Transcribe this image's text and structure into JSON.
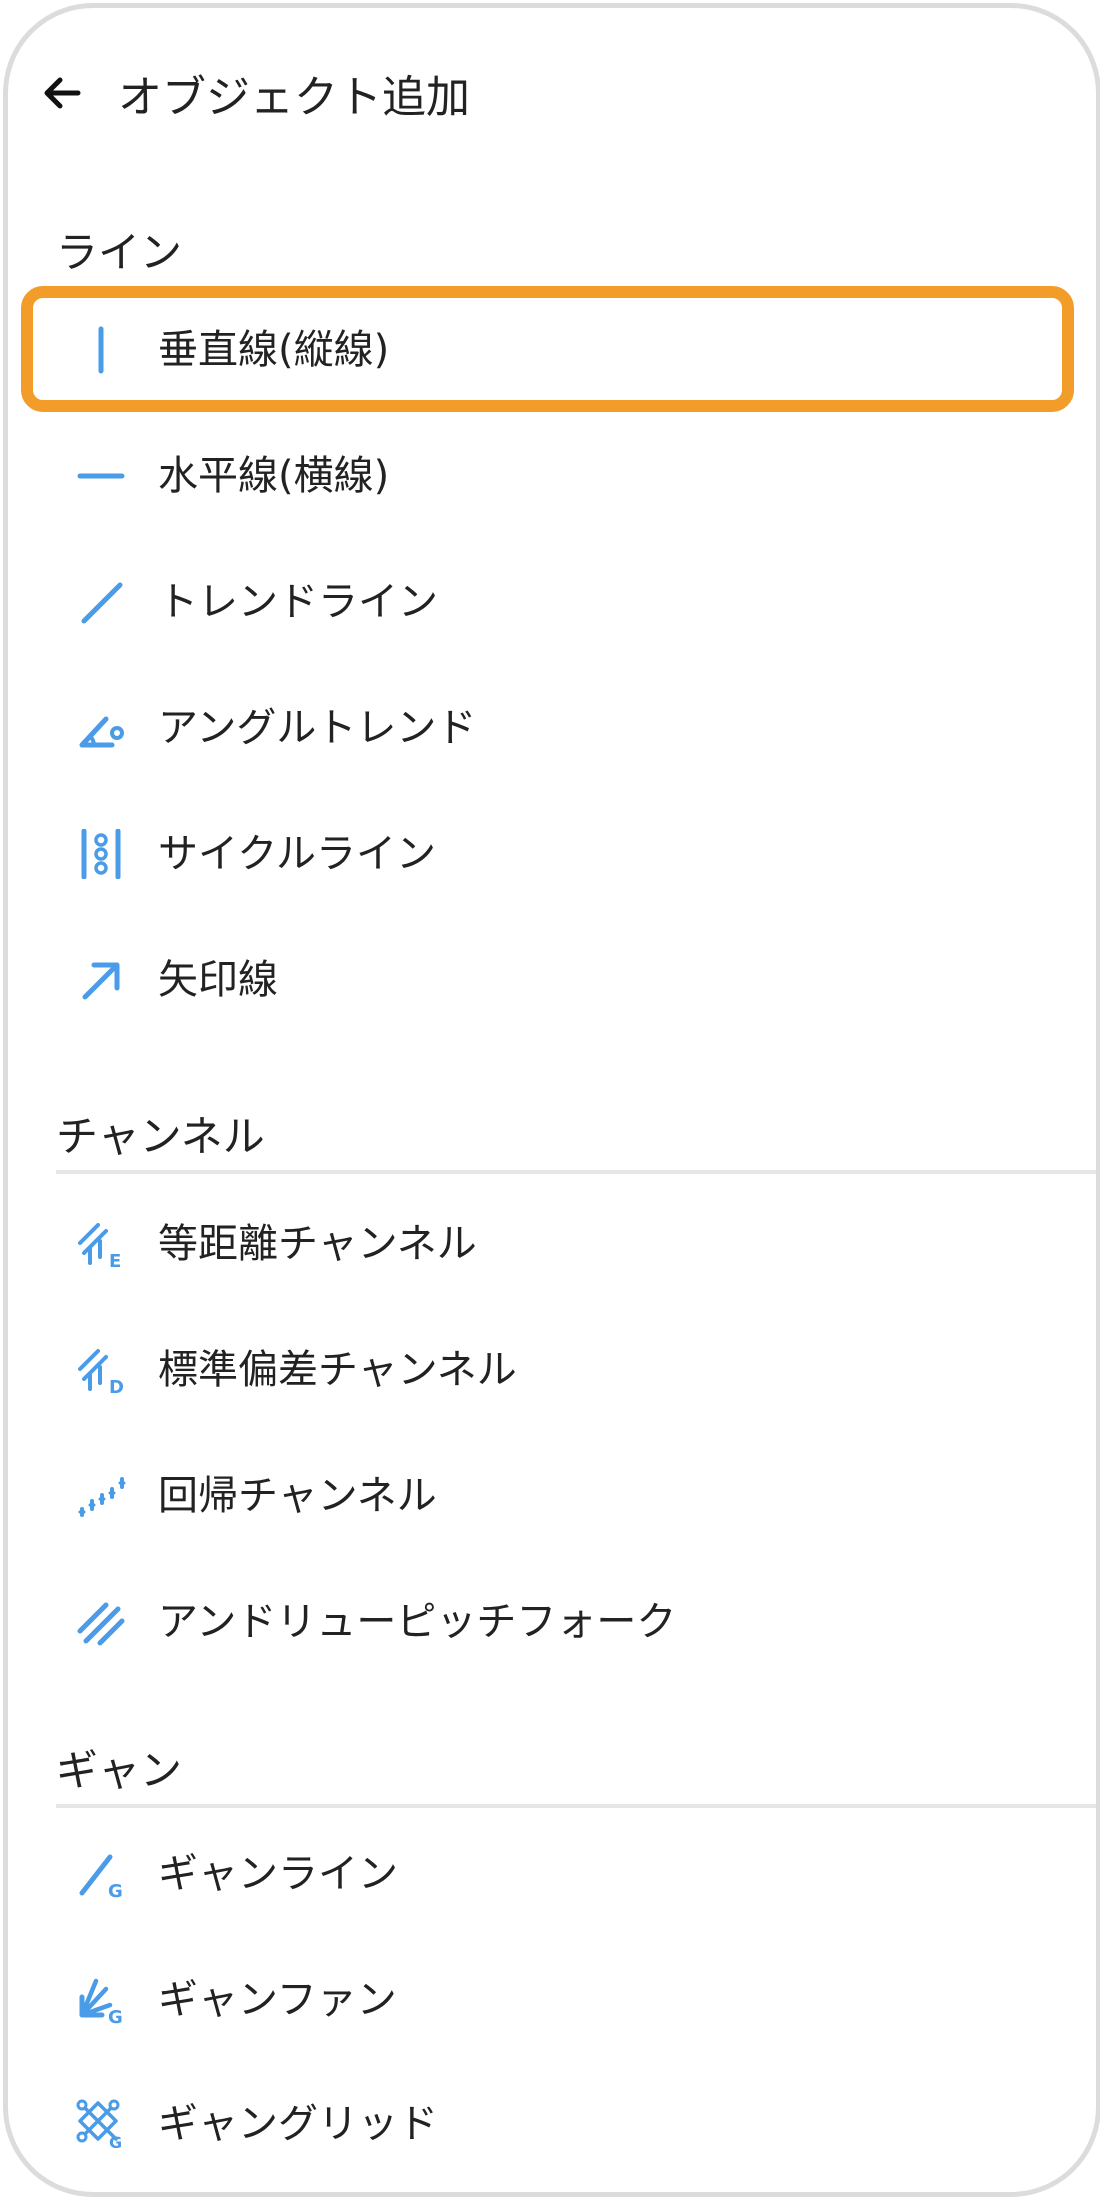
{
  "header": {
    "title": "オブジェクト追加",
    "back_icon": "arrow-left-icon"
  },
  "accent_color": "#4a9be8",
  "highlight_color": "#f29d2a",
  "sections": [
    {
      "title": "ライン",
      "items": [
        {
          "label": "垂直線(縦線)",
          "icon": "vertical-line-icon"
        },
        {
          "label": "水平線(横線)",
          "icon": "horizontal-line-icon"
        },
        {
          "label": "トレンドライン",
          "icon": "trend-line-icon"
        },
        {
          "label": "アングルトレンド",
          "icon": "angle-trend-icon"
        },
        {
          "label": "サイクルライン",
          "icon": "cycle-line-icon"
        },
        {
          "label": "矢印線",
          "icon": "arrow-line-icon"
        }
      ]
    },
    {
      "title": "チャンネル",
      "items": [
        {
          "label": "等距離チャンネル",
          "icon": "equidistant-channel-icon"
        },
        {
          "label": "標準偏差チャンネル",
          "icon": "std-deviation-channel-icon"
        },
        {
          "label": "回帰チャンネル",
          "icon": "regression-channel-icon"
        },
        {
          "label": "アンドリューピッチフォーク",
          "icon": "andrews-pitchfork-icon"
        }
      ]
    },
    {
      "title": "ギャン",
      "items": [
        {
          "label": "ギャンライン",
          "icon": "gann-line-icon"
        },
        {
          "label": "ギャンファン",
          "icon": "gann-fan-icon"
        },
        {
          "label": "ギャングリッド",
          "icon": "gann-grid-icon"
        }
      ]
    }
  ]
}
